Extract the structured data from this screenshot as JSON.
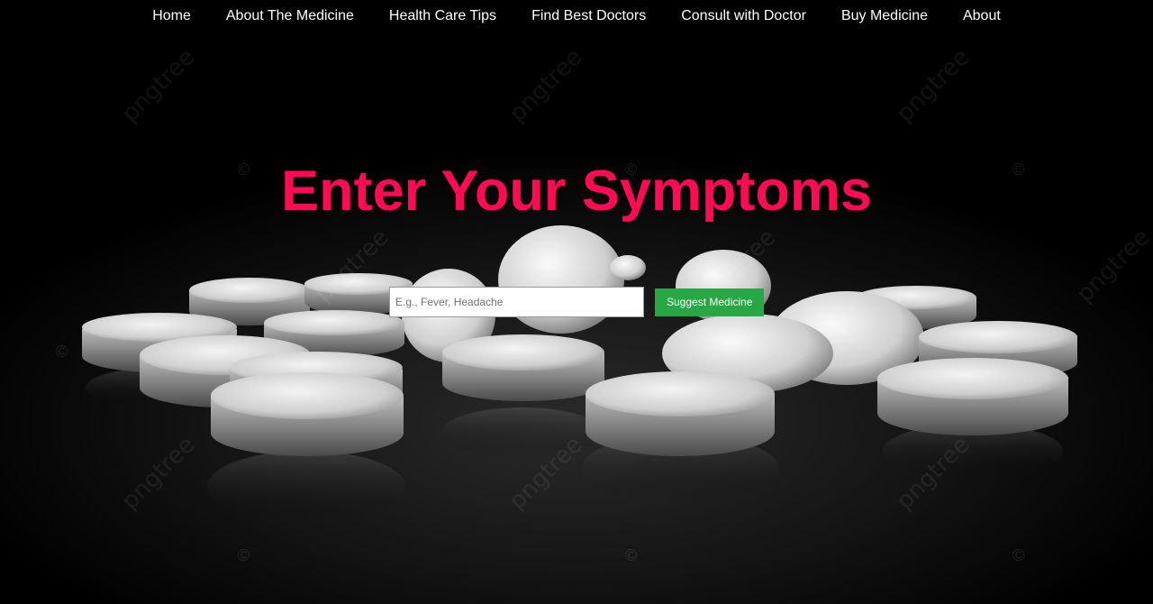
{
  "nav": {
    "items": [
      {
        "label": "Home"
      },
      {
        "label": "About The Medicine"
      },
      {
        "label": "Health Care Tips"
      },
      {
        "label": "Find Best Doctors"
      },
      {
        "label": "Consult with Doctor"
      },
      {
        "label": "Buy Medicine"
      },
      {
        "label": "About"
      }
    ]
  },
  "hero": {
    "title": "Enter Your Symptoms",
    "title_color": "#ff0a55"
  },
  "search": {
    "value": "",
    "placeholder": "E.g., Fever, Headache",
    "button_label": "Suggest Medicine",
    "button_color": "#28a745"
  },
  "background": {
    "image": "white-pills-on-black",
    "watermark_text": "pngtree",
    "copyright_symbol": "©"
  }
}
